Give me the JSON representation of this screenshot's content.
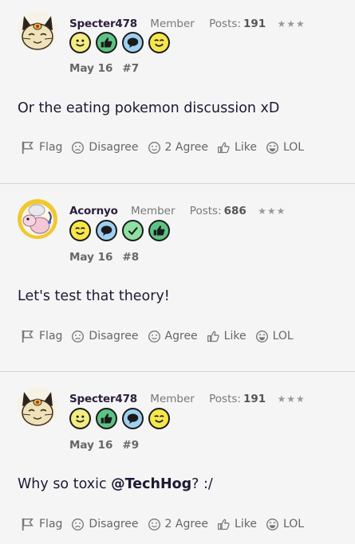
{
  "posts": [
    {
      "username": "Specter478",
      "role": "Member",
      "posts_label": "Posts:",
      "posts_count": "191",
      "stars": "★★★",
      "avatar": "meowth-avatar",
      "badges": [
        "smile-icon",
        "thumbs-up-icon",
        "speech-bubble-icon",
        "wink-icon"
      ],
      "date": "May 16",
      "post_number": "#7",
      "message": "Or the eating pokemon discussion xD",
      "mention": "",
      "message_suffix": "",
      "actions": {
        "flag": "Flag",
        "disagree": "Disagree",
        "agree": "2 Agree",
        "like": "Like",
        "lol": "LOL"
      }
    },
    {
      "username": "Acornyo",
      "role": "Member",
      "posts_label": "Posts:",
      "posts_count": "686",
      "stars": "★★★",
      "avatar": "flaaffy-avatar",
      "badges": [
        "wink-icon",
        "speech-bubble-icon",
        "check-icon",
        "thumbs-up-icon"
      ],
      "date": "May 16",
      "post_number": "#8",
      "message": "Let's test that theory!",
      "mention": "",
      "message_suffix": "",
      "actions": {
        "flag": "Flag",
        "disagree": "Disagree",
        "agree": "Agree",
        "like": "Like",
        "lol": "LOL"
      }
    },
    {
      "username": "Specter478",
      "role": "Member",
      "posts_label": "Posts:",
      "posts_count": "191",
      "stars": "★★★",
      "avatar": "meowth-avatar",
      "badges": [
        "smile-icon",
        "thumbs-up-icon",
        "speech-bubble-icon",
        "wink-icon"
      ],
      "date": "May 16",
      "post_number": "#9",
      "message": "Why so toxic ",
      "mention": "@TechHog",
      "message_suffix": "? :/",
      "actions": {
        "flag": "Flag",
        "disagree": "Disagree",
        "agree": "2 Agree",
        "like": "Like",
        "lol": "LOL"
      }
    }
  ],
  "colors": {
    "smile": "#f3ec80",
    "thumbs": "#5cc384",
    "speech": "#9fd0f0",
    "check": "#8fe0a2",
    "wink": "#f7e64a"
  }
}
